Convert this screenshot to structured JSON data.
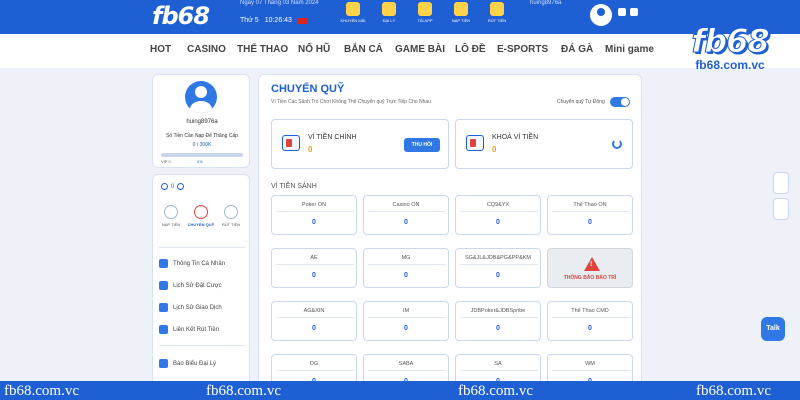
{
  "header": {
    "logo": "fb68",
    "top_text": "Ngày 07 Tháng 03 Năm 2024",
    "weekday": "Thứ 5",
    "time": "10:26:43",
    "icons": [
      {
        "icon": "deposit-icon",
        "label": "KHUYẾN MÃI"
      },
      {
        "icon": "agency-icon",
        "label": "ĐẠI LÝ"
      },
      {
        "icon": "app-icon",
        "label": "TẢI APP"
      },
      {
        "icon": "deposit-icon",
        "label": "NẠP TIỀN"
      },
      {
        "icon": "withdraw-icon",
        "label": "RÚT TIỀN"
      }
    ],
    "top_right_text": "huing8976a"
  },
  "nav": {
    "items": [
      "HOT",
      "CASINO",
      "THỂ THAO",
      "NỔ HŨ",
      "BẮN CÁ",
      "GAME BÀI",
      "LÔ ĐỀ",
      "E-SPORTS",
      "ĐÁ GÀ",
      "Mini game"
    ]
  },
  "brand": {
    "name": "fb68",
    "domain": "fb68.com.vc"
  },
  "profile": {
    "username": "huing8976a",
    "level_label": "Số Tiền Cần Nạp Để Thăng Cấp",
    "level_value": "0 / 300K",
    "vip": "VIP 0",
    "percent": "0%"
  },
  "left": {
    "balance": "0",
    "quick_actions": [
      {
        "label": "NẠP TIỀN"
      },
      {
        "label": "CHUYỂN QUỸ"
      },
      {
        "label": "RÚT TIỀN"
      }
    ],
    "menu": [
      "Thông Tin Cá Nhân",
      "Lịch Sử Đặt Cược",
      "Lịch Sử Giao Dịch",
      "Liên Kết Rút Tiền",
      "Báo Biểu Đại Lý"
    ]
  },
  "main": {
    "title": "CHUYỂN QUỸ",
    "subtitle": "Ví Tiền Các Sảnh Trò Chơi Không Thể Chuyển quỹ Trực Tiếp Cho Nhau",
    "auto_label": "Chuyển quỹ Tự Động",
    "main_wallet": {
      "name": "VÍ TIỀN CHÍNH",
      "value": "0",
      "button": "THU HỒI"
    },
    "locked_wallet": {
      "name": "KHOÁ VÍ TIỀN",
      "value": "0"
    },
    "section_title": "VÍ TIỀN SẢNH",
    "games": [
      {
        "name": "Poker ON",
        "value": "0"
      },
      {
        "name": "Casino ON",
        "value": "0"
      },
      {
        "name": "CQ9&YX",
        "value": "0"
      },
      {
        "name": "Thể Thao ON",
        "value": "0"
      },
      {
        "name": "AE",
        "value": "0"
      },
      {
        "name": "MG",
        "value": "0"
      },
      {
        "name": "SG&JL&JDB&PG&PP&KM",
        "value": "0"
      },
      {
        "name": "",
        "value": "",
        "maintenance": "THÔNG BÁO BẢO TRÌ"
      },
      {
        "name": "AG&XIN",
        "value": "0"
      },
      {
        "name": "IM",
        "value": "0"
      },
      {
        "name": "JDBPoker&JDBSpribe",
        "value": "0"
      },
      {
        "name": "Thể Thao CMD",
        "value": "0"
      },
      {
        "name": "DG",
        "value": "0"
      },
      {
        "name": "SABA",
        "value": "0"
      },
      {
        "name": "SA",
        "value": "0"
      },
      {
        "name": "WM",
        "value": "0"
      }
    ]
  },
  "talk": "Talk",
  "footer": {
    "watermark": "fb68.com.vc"
  }
}
